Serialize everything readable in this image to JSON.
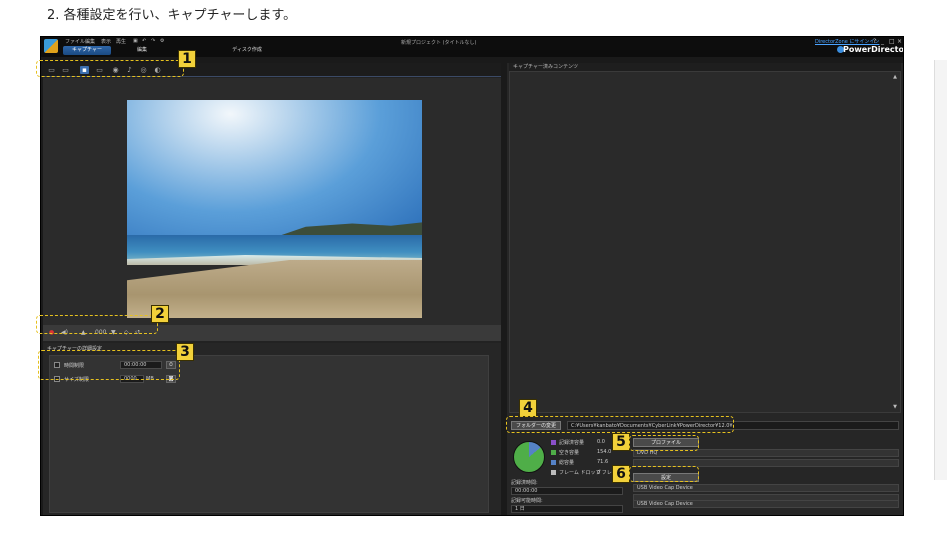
{
  "instruction": "2. 各種設定を行い、キャプチャーします。",
  "menubar": {
    "items": [
      "ファイル",
      "編集",
      "表示",
      "再生"
    ],
    "window_title": "新規プロジェクト (タイトルなし)",
    "signin": "DirectorZone にサインイン",
    "brand": "PowerDirector"
  },
  "tabs": {
    "capture": "キャプチャー",
    "edit": "編集",
    "disc": "ディスク作成"
  },
  "capture_settings": {
    "title": "キャプチャーの詳細設定",
    "time_limit_label": "時間制限",
    "time_limit_value": "00:00:00",
    "size_limit_label": "サイズ制限",
    "size_limit_value": "0000",
    "size_unit": "MB"
  },
  "playback": {
    "counter": "000"
  },
  "content_panel": {
    "title": "キャプチャー済みコンテンツ"
  },
  "folder": {
    "change_button": "フォルダーの変更",
    "path": "C:¥Users¥kanbato¥Documents¥CyberLink¥PowerDirector¥12.0¥"
  },
  "storage": {
    "legend": [
      {
        "label": "記録済容量",
        "value": "0.0",
        "color": "#8a4fc9"
      },
      {
        "label": "空き容量",
        "value": "154.0",
        "color": "#4fae48"
      },
      {
        "label": "総容量",
        "value": "71.6",
        "color": "#5582c6"
      },
      {
        "label": "フレーム ドロップ",
        "value": "0 フレーム",
        "color": "#bbbbbb"
      }
    ],
    "recorded_time_label": "記録済時間:",
    "recorded_time_value": "00:00:00",
    "recordable_time_label": "記録可能時間:",
    "recordable_time_value": "1 日"
  },
  "profile": {
    "button": "プロファイル",
    "value": "DVD HQ",
    "settings_button": "設定",
    "device1": "USB Video Cap Device",
    "device2": "USB Video Cap Device"
  },
  "callouts": [
    "1",
    "2",
    "3",
    "4",
    "5",
    "6"
  ]
}
